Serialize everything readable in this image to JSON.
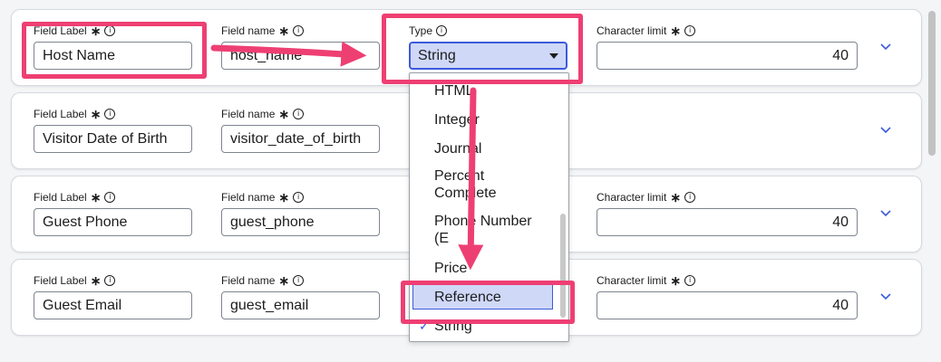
{
  "rows": [
    {
      "field_label_title": "Field Label",
      "field_label_value": "Host Name",
      "field_name_title": "Field name",
      "field_name_value": "host_name",
      "type_title": "Type",
      "type_value": "String",
      "char_limit_title": "Character limit",
      "char_limit_value": "40"
    },
    {
      "field_label_title": "Field Label",
      "field_label_value": "Visitor Date of Birth",
      "field_name_title": "Field name",
      "field_name_value": "visitor_date_of_birth"
    },
    {
      "field_label_title": "Field Label",
      "field_label_value": "Guest Phone",
      "field_name_title": "Field name",
      "field_name_value": "guest_phone",
      "char_limit_title": "Character limit",
      "char_limit_value": "40"
    },
    {
      "field_label_title": "Field Label",
      "field_label_value": "Guest Email",
      "field_name_title": "Field name",
      "field_name_value": "guest_email",
      "char_limit_title": "Character limit",
      "char_limit_value": "40"
    }
  ],
  "type_dropdown": {
    "options": [
      "HTML",
      "Integer",
      "Journal",
      "Percent Complete",
      "Phone Number (E",
      "Price",
      "Reference",
      "String"
    ],
    "highlighted": "Reference",
    "checked": "String"
  },
  "symbols": {
    "required": "∗",
    "info": "i",
    "check": "✓"
  },
  "colors": {
    "annotation": "#ee3f73",
    "accent": "#3b5bdb",
    "selected_bg": "#cfd8f7"
  },
  "icons": [
    "asterisk-icon",
    "info-icon",
    "chevron-down-icon",
    "caret-down-icon",
    "checkmark-icon",
    "arrow-annotation"
  ]
}
